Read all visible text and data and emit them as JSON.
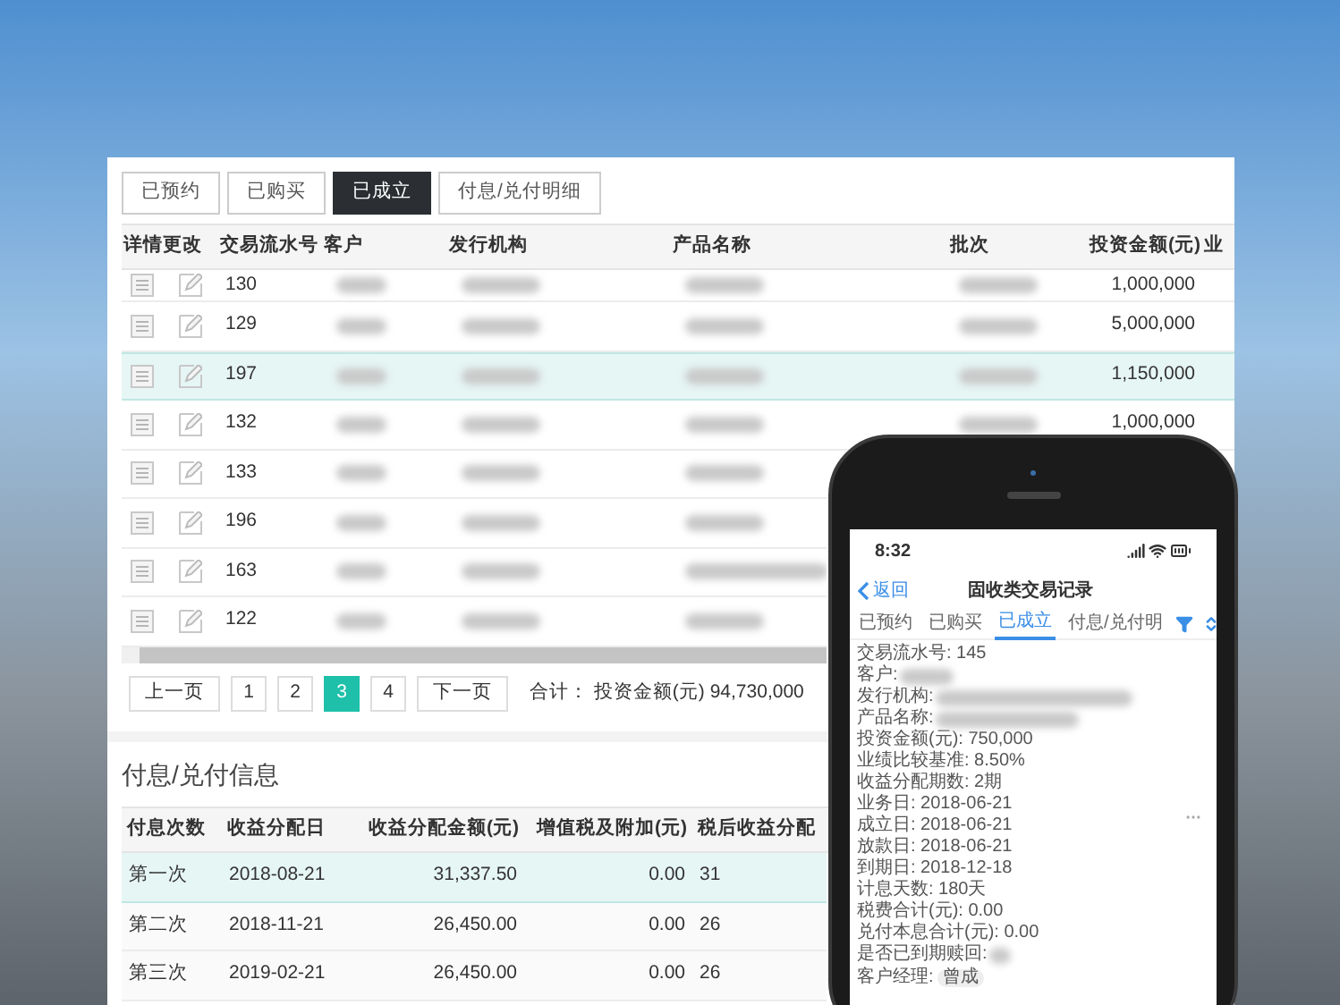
{
  "desktop": {
    "tabs": [
      {
        "label": "已预约",
        "selected": false
      },
      {
        "label": "已购买",
        "selected": false
      },
      {
        "label": "已成立",
        "selected": true
      },
      {
        "label": "付息/兑付明细",
        "selected": false
      }
    ],
    "table": {
      "columns": [
        "详情",
        "更改",
        "交易流水号",
        "客户",
        "发行机构",
        "产品名称",
        "批次",
        "投资金额(元)",
        "业"
      ],
      "rows": [
        {
          "serial": "130",
          "amount": "1,000,000",
          "selected": false
        },
        {
          "serial": "129",
          "amount": "5,000,000",
          "selected": false
        },
        {
          "serial": "197",
          "amount": "1,150,000",
          "selected": true
        },
        {
          "serial": "132",
          "amount": "1,000,000",
          "selected": false
        },
        {
          "serial": "133",
          "selected": false
        },
        {
          "serial": "196",
          "selected": false
        },
        {
          "serial": "163",
          "selected": false
        },
        {
          "serial": "122",
          "selected": false
        }
      ]
    },
    "pagination": {
      "prev": "上一页",
      "pages": [
        {
          "label": "1",
          "selected": false
        },
        {
          "label": "2",
          "selected": false
        },
        {
          "label": "3",
          "selected": true
        },
        {
          "label": "4",
          "selected": false
        }
      ],
      "next": "下一页",
      "total": "合计： 投资金额(元) 94,730,000"
    },
    "payment_section": {
      "title": "付息/兑付信息",
      "columns": [
        "付息次数",
        "收益分配日",
        "收益分配金额(元)",
        "增值税及附加(元)",
        "税后收益分配"
      ],
      "rows": [
        {
          "cells": [
            "第一次",
            "2018-08-21",
            "31,337.50",
            "0.00",
            "31"
          ],
          "selected": true
        },
        {
          "cells": [
            "第二次",
            "2018-11-21",
            "26,450.00",
            "0.00",
            "26"
          ],
          "selected": false
        },
        {
          "cells": [
            "第三次",
            "2019-02-21",
            "26,450.00",
            "0.00",
            "26"
          ],
          "selected": false
        }
      ]
    }
  },
  "phone": {
    "time": "8:32",
    "back": "返回",
    "title": "固收类交易记录",
    "tabs": [
      {
        "label": "已预约",
        "selected": false
      },
      {
        "label": "已购买",
        "selected": false
      },
      {
        "label": "已成立",
        "selected": true
      },
      {
        "label": "付息/兑付明",
        "selected": false
      }
    ],
    "details": [
      {
        "kind": "text",
        "text": "交易流水号: 145"
      },
      {
        "kind": "mask",
        "text": "客户:"
      },
      {
        "kind": "mask",
        "text": "发行机构:"
      },
      {
        "kind": "mask",
        "text": "产品名称:"
      },
      {
        "kind": "text",
        "text": "投资金额(元): 750,000"
      },
      {
        "kind": "text",
        "text": "业绩比较基准: 8.50%"
      },
      {
        "kind": "text",
        "text": "收益分配期数: 2期"
      },
      {
        "kind": "text",
        "text": "业务日: 2018-06-21"
      },
      {
        "kind": "text",
        "text": "成立日: 2018-06-21"
      },
      {
        "kind": "text",
        "text": "放款日: 2018-06-21"
      },
      {
        "kind": "text",
        "text": "到期日: 2018-12-18"
      },
      {
        "kind": "text",
        "text": "计息天数: 180天"
      },
      {
        "kind": "text",
        "text": "税费合计(元): 0.00"
      },
      {
        "kind": "text",
        "text": "兑付本息合计(元): 0.00"
      },
      {
        "kind": "mask",
        "text": "是否已到期赎回:"
      },
      {
        "kind": "tag",
        "text": "客户经理:",
        "value": "曾成"
      }
    ]
  }
}
